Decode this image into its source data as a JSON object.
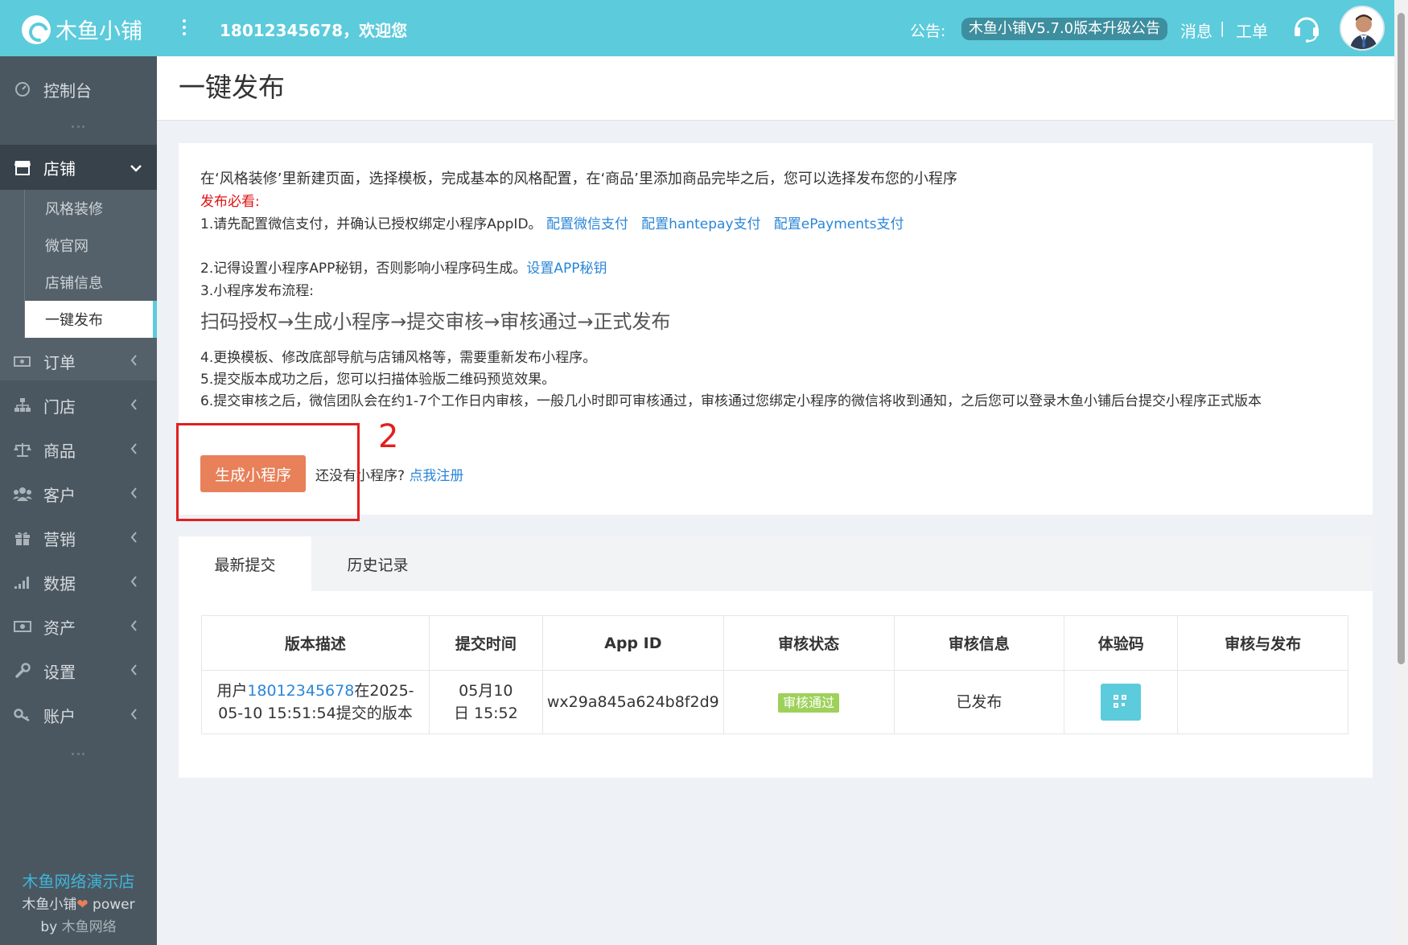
{
  "app": {
    "logo_text": "木鱼小铺",
    "welcome": "18012345678，欢迎您",
    "notice_label": "公告:",
    "notice_text": "木鱼小铺V5.7.0版本升级公告",
    "messages": "消息",
    "separator": "|",
    "tickets": "工单"
  },
  "sidebar": {
    "console": "控制台",
    "store": "店铺",
    "store_sub": [
      "风格装修",
      "微官网",
      "店铺信息",
      "一键发布"
    ],
    "items": [
      "订单",
      "门店",
      "商品",
      "客户",
      "营销",
      "数据",
      "资产",
      "设置",
      "账户"
    ],
    "footer_shop": "木鱼网络演示店",
    "footer_power_prefix": "木鱼小铺",
    "footer_power_suffix": " power",
    "footer_by": "by ",
    "footer_by_name": "木鱼网络"
  },
  "page": {
    "title": "一键发布"
  },
  "info": {
    "intro": "在‘风格装修’里新建页面，选择模板，完成基本的风格配置，在‘商品’里添加商品完毕之后，您可以选择发布您的小程序",
    "must_read": "发布必看:",
    "step1": "1.请先配置微信支付，并确认已授权绑定小程序AppID。",
    "link_wechat_pay": "配置微信支付",
    "link_hantepay": "配置hantepay支付",
    "link_epayments": "配置ePayments支付",
    "step2": " 2.记得设置小程序APP秘钥，否则影响小程序码生成。",
    "link_app_secret": "设置APP秘钥",
    "step3": "3.小程序发布流程:",
    "flow": "扫码授权→生成小程序→提交审核→审核通过→正式发布",
    "step4": "4.更换模板、修改底部导航与店铺风格等，需要重新发布小程序。",
    "step5": "5.提交版本成功之后，您可以扫描体验版二维码预览效果。",
    "step6": "6.提交审核之后，微信团队会在约1-7个工作日内审核，一般几小时即可审核通过，审核通过您绑定小程序的微信将收到通知，之后您可以登录木鱼小铺后台提交小程序正式版本",
    "generate_button": "生成小程序",
    "no_app_text": "还没有小程序?",
    "register_link": "点我注册",
    "annotation_number": "2"
  },
  "tabs": [
    "最新提交",
    "历史记录"
  ],
  "table": {
    "headers": [
      "版本描述",
      "提交时间",
      "App ID",
      "审核状态",
      "审核信息",
      "体验码",
      "审核与发布"
    ],
    "rows": [
      {
        "desc_prefix": "用户",
        "desc_user": "18012345678",
        "desc_suffix": "在2025-05-10 15:51:54提交的版本",
        "time": "05月10日 15:52",
        "app_id": "wx29a845a624b8f2d9",
        "status": "审核通过",
        "review_info": "已发布",
        "qr_icon": "qrcode-icon",
        "publish": ""
      }
    ]
  },
  "colors": {
    "topbar": "#5ccbdc",
    "sidebar": "#4b5760",
    "button": "#e8805a",
    "badge": "#9ed15a",
    "link": "#2a86d8",
    "annotation": "#e02020"
  }
}
